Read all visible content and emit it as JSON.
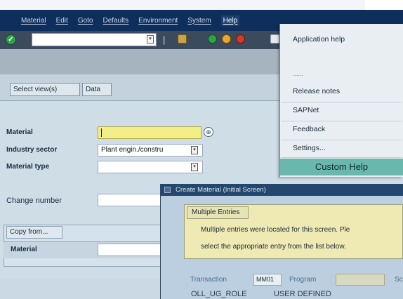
{
  "menu": {
    "items": [
      "Material",
      "Edit",
      "Goto",
      "Defaults",
      "Environment",
      "System",
      "Help"
    ]
  },
  "app_toolbar": {
    "select_views": "Select view(s)",
    "data": "Data"
  },
  "form": {
    "material_label": "Material",
    "industry_label": "Industry sector",
    "industry_value": "Plant engin./constru",
    "material_type_label": "Material type",
    "change_number_label": "Change number",
    "copy_from_title": "Copy from...",
    "copy_material_label": "Material"
  },
  "help_menu": {
    "application_help": "Application help",
    "hidden_item": "......",
    "release_notes": "Release notes",
    "sapnet": "SAPNet",
    "feedback": "Feedback",
    "settings": "Settings...",
    "custom_help": "Custom Help"
  },
  "popup": {
    "title": "Create Material (Initial Screen)",
    "tab": "Multiple Entries",
    "line1": "Multiple entries were located for this screen. Ple",
    "line2": "select the appropriate entry from the list below.",
    "transaction_label": "Transaction",
    "transaction_value": "MM01",
    "program_label": "Program",
    "sc_label": "Sc",
    "row_col1": "OLL_UG_ROLE",
    "row_col2": "USER DEFINED"
  },
  "colors": {
    "menubar": "#0e2e5b",
    "custom_help": "#6ab8ad",
    "material_field": "#f3ef88"
  }
}
